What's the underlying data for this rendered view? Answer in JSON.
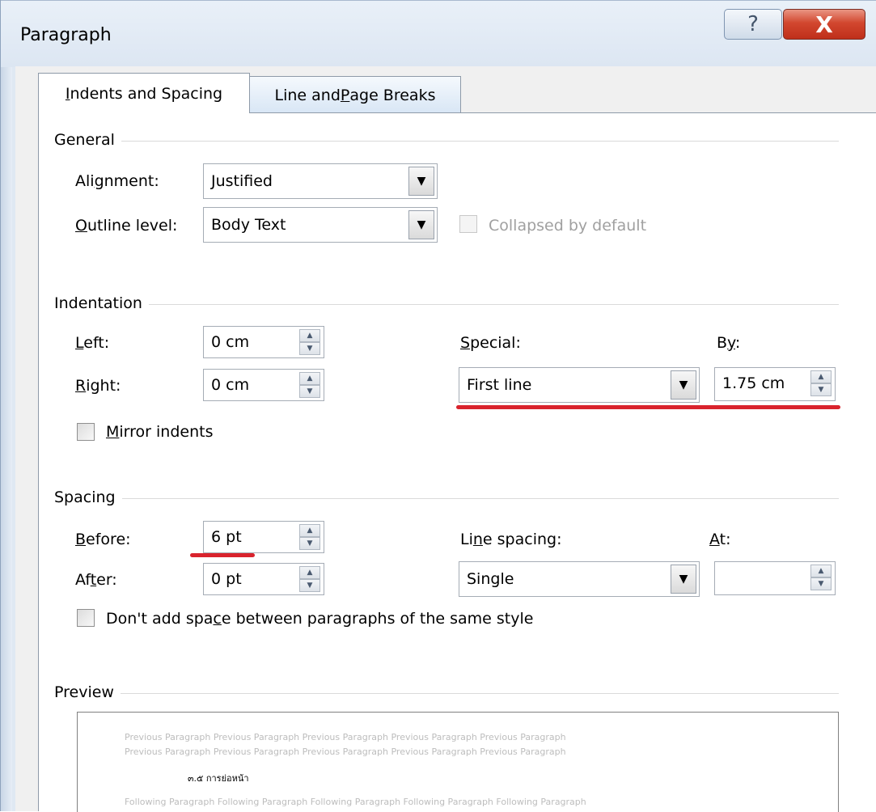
{
  "window": {
    "title": "Paragraph",
    "help_icon": "?",
    "close_icon": "X"
  },
  "tabs": [
    {
      "pre": "",
      "key": "I",
      "post": "ndents and Spacing",
      "active": true
    },
    {
      "pre": "Line and ",
      "key": "P",
      "post": "age Breaks",
      "active": false
    }
  ],
  "general": {
    "title": "General",
    "alignment": {
      "pre": "Ali",
      "key": "g",
      "post": "nment:",
      "value": "Justified"
    },
    "outline_level": {
      "pre": "",
      "key": "O",
      "post": "utline level:",
      "value": "Body Text"
    },
    "collapsed": {
      "label": "Collapsed by default",
      "checked": false,
      "enabled": false
    }
  },
  "indentation": {
    "title": "Indentation",
    "left": {
      "pre": "",
      "key": "L",
      "post": "eft:",
      "value": "0 cm"
    },
    "right": {
      "pre": "",
      "key": "R",
      "post": "ight:",
      "value": "0 cm"
    },
    "special": {
      "pre": "",
      "key": "S",
      "post": "pecial:",
      "value": "First line"
    },
    "by": {
      "pre": "B",
      "key": "y",
      "post": ":",
      "value": "1.75 cm"
    },
    "mirror": {
      "pre": "",
      "key": "M",
      "post": "irror indents",
      "checked": false
    }
  },
  "spacing": {
    "title": "Spacing",
    "before": {
      "pre": "",
      "key": "B",
      "post": "efore:",
      "value": "6 pt"
    },
    "after": {
      "pre": "Af",
      "key": "t",
      "post": "er:",
      "value": "0 pt"
    },
    "line_spacing": {
      "pre": "Li",
      "key": "n",
      "post": "e spacing:",
      "value": "Single"
    },
    "at": {
      "pre": "",
      "key": "A",
      "post": "t:",
      "value": ""
    },
    "dont_add": {
      "pre": "Don't add spa",
      "key": "c",
      "post": "e between paragraphs of the same style",
      "checked": false
    }
  },
  "preview": {
    "title": "Preview",
    "previous_line1": "Previous Paragraph Previous Paragraph Previous Paragraph Previous Paragraph Previous Paragraph",
    "previous_line2": "Previous Paragraph Previous Paragraph Previous Paragraph Previous Paragraph Previous Paragraph",
    "current_text": "๓.๕ การย่อหน้า",
    "following_line1": "Following Paragraph Following Paragraph Following Paragraph Following Paragraph Following Paragraph"
  },
  "annotation_color": "#d9232d"
}
